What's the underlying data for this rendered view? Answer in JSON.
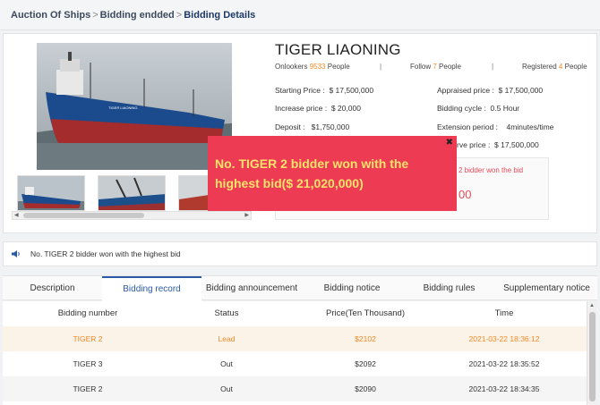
{
  "breadcrumb": {
    "item1": "Auction Of Ships",
    "item2": "Bidding endded",
    "item3": "Bidding Details",
    "separator": ">"
  },
  "toolbar": {
    "icons": [
      "document-icon",
      "fullscreen-icon",
      "save-icon",
      "share-icon",
      "settings-icon"
    ],
    "accent_color": "#3a9a5a"
  },
  "ship": {
    "title": "TIGER LIAONING",
    "hull_name": "TIGER LIAONING"
  },
  "stats": {
    "onlookers_label": "Onlookers",
    "onlookers_value": "9533",
    "onlookers_unit": "People",
    "follow_label": "Follow",
    "follow_value": "7",
    "follow_unit": "People",
    "registered_label": "Registered",
    "registered_value": "4",
    "registered_unit": "People",
    "divider": "|"
  },
  "info": {
    "starting_price": "Starting Price :  $ 17,500,000",
    "appraised_price": "Appraised price :  $ 17,500,000",
    "increase_price": "Increase price :  $ 20,000",
    "bidding_cycle": "Bidding cycle :  0.5 Hour",
    "deposit": "Deposit :   $1,750,000",
    "extension_period": "Extension period :    4minutes/time",
    "reserve_price_partial": "rve price :  $ 17,500,000"
  },
  "win_box": {
    "text_partial": "2 bidder won the bid",
    "price_partial": "00"
  },
  "popup": {
    "message": "No. TIGER 2 bidder won with the highest bid($ 21,020,000)",
    "close_glyph": "✖",
    "bg_color": "#ed3b53",
    "text_color": "#fbe36a"
  },
  "notice": {
    "text": "No. TIGER 2 bidder won with the highest bid"
  },
  "tabs": [
    {
      "label": "Description"
    },
    {
      "label": "Bidding record"
    },
    {
      "label": "Bidding announcement"
    },
    {
      "label": "Bidding notice"
    },
    {
      "label": "Bidding rules"
    },
    {
      "label": "Supplementary notice"
    }
  ],
  "active_tab": "Bidding record",
  "table": {
    "headers": [
      "Bidding number",
      "Status",
      "Price(Ten Thousand)",
      "Time"
    ],
    "rows": [
      {
        "number": "TIGER 2",
        "status": "Lead",
        "price": "$2102",
        "time": "2021-03-22 18:36:12"
      },
      {
        "number": "TIGER 3",
        "status": "Out",
        "price": "$2092",
        "time": "2021-03-22 18:35:52"
      },
      {
        "number": "TIGER 2",
        "status": "Out",
        "price": "$2090",
        "time": "2021-03-22 18:34:35"
      }
    ],
    "highlight_color": "#f08a24"
  }
}
